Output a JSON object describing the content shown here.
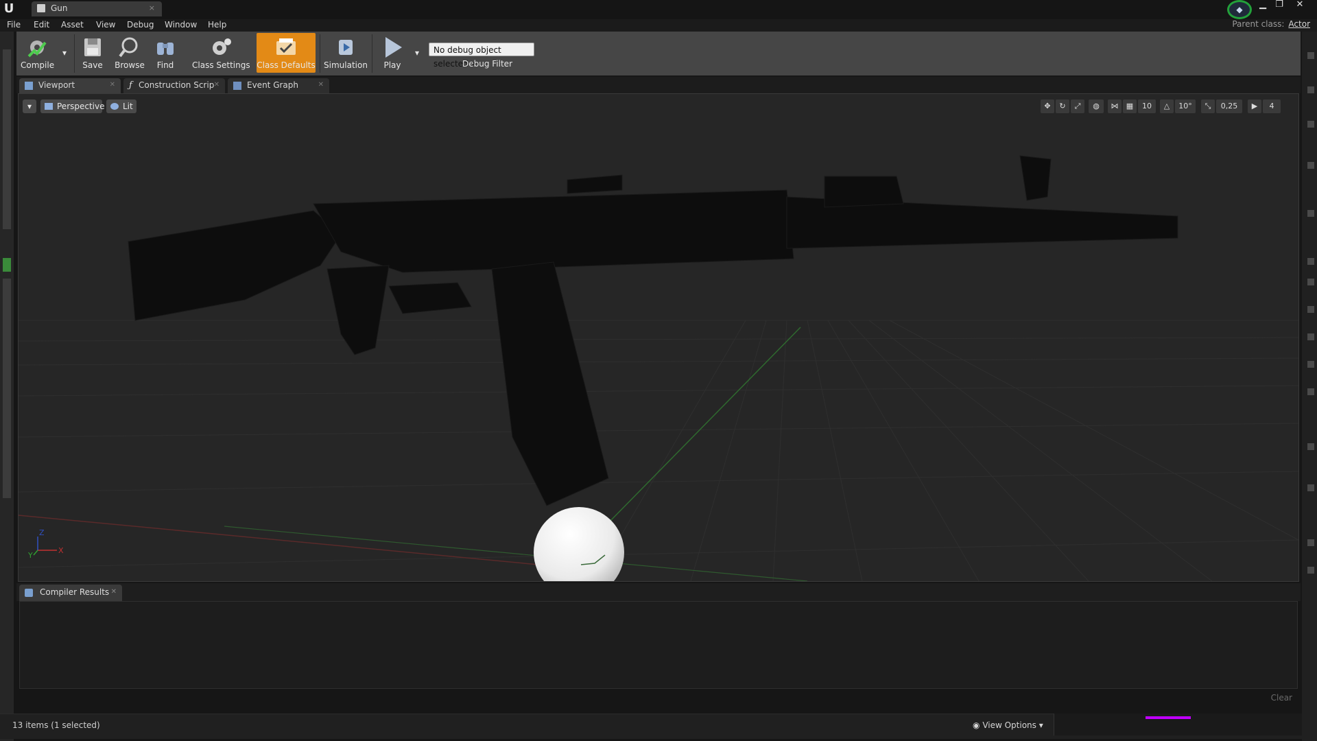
{
  "window": {
    "logo": "U",
    "tab_title": "Gun",
    "close_glyph": "×",
    "minimize_glyph": "▁",
    "maximize_glyph": "❐",
    "window_close_glyph": "✕"
  },
  "menu": {
    "items": [
      "File",
      "Edit",
      "Asset",
      "View",
      "Debug",
      "Window",
      "Help"
    ],
    "parent_class_label": "Parent class:",
    "parent_class_value": "Actor"
  },
  "toolbar": {
    "compile": "Compile",
    "save": "Save",
    "browse": "Browse",
    "find": "Find",
    "class_settings": "Class Settings",
    "class_defaults": "Class Defaults",
    "simulation": "Simulation",
    "play": "Play",
    "debug_select": "No debug object selected",
    "debug_filter": "Debug Filter",
    "accent_color": "#e38a16"
  },
  "tabs": [
    {
      "label": "Viewport",
      "icon": "viewport-icon"
    },
    {
      "label": "Construction Scrip",
      "icon": "function-icon"
    },
    {
      "label": "Event Graph",
      "icon": "graph-icon"
    }
  ],
  "viewport": {
    "perspective": "Perspective",
    "lit": "Lit",
    "grid_snap": "10",
    "rotation_snap": "10°",
    "scale_snap": "0,25",
    "camera_speed": "4",
    "axis_x": "X",
    "axis_y": "Y",
    "axis_z": "Z"
  },
  "results": {
    "tab_label": "Compiler Results",
    "clear": "Clear"
  },
  "status": {
    "items": "13 items (1 selected)",
    "view_options": "View Options"
  }
}
